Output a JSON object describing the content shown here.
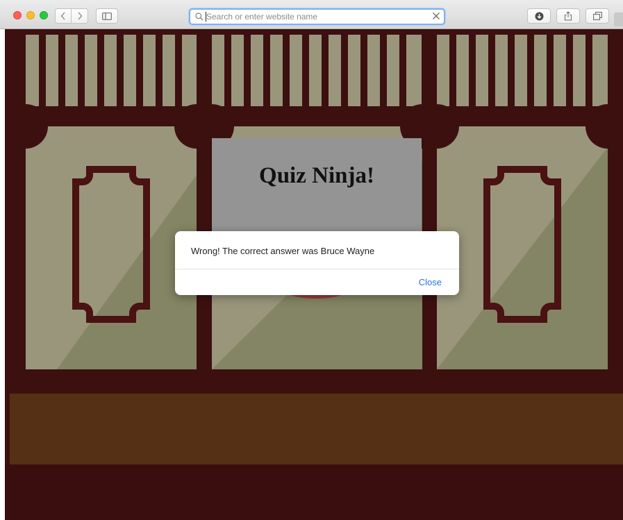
{
  "browser": {
    "address_placeholder": "Search or enter website name",
    "address_value": ""
  },
  "page": {
    "title": "Quiz Ninja!"
  },
  "dialog": {
    "message": "Wrong! The correct answer was Bruce Wayne",
    "close_label": "Close"
  },
  "colors": {
    "wall": "#3d1010",
    "panel_light": "#9a967c",
    "panel_dark": "#848564",
    "shelf": "#553015",
    "card": "#949494",
    "link_blue": "#2a71de"
  }
}
